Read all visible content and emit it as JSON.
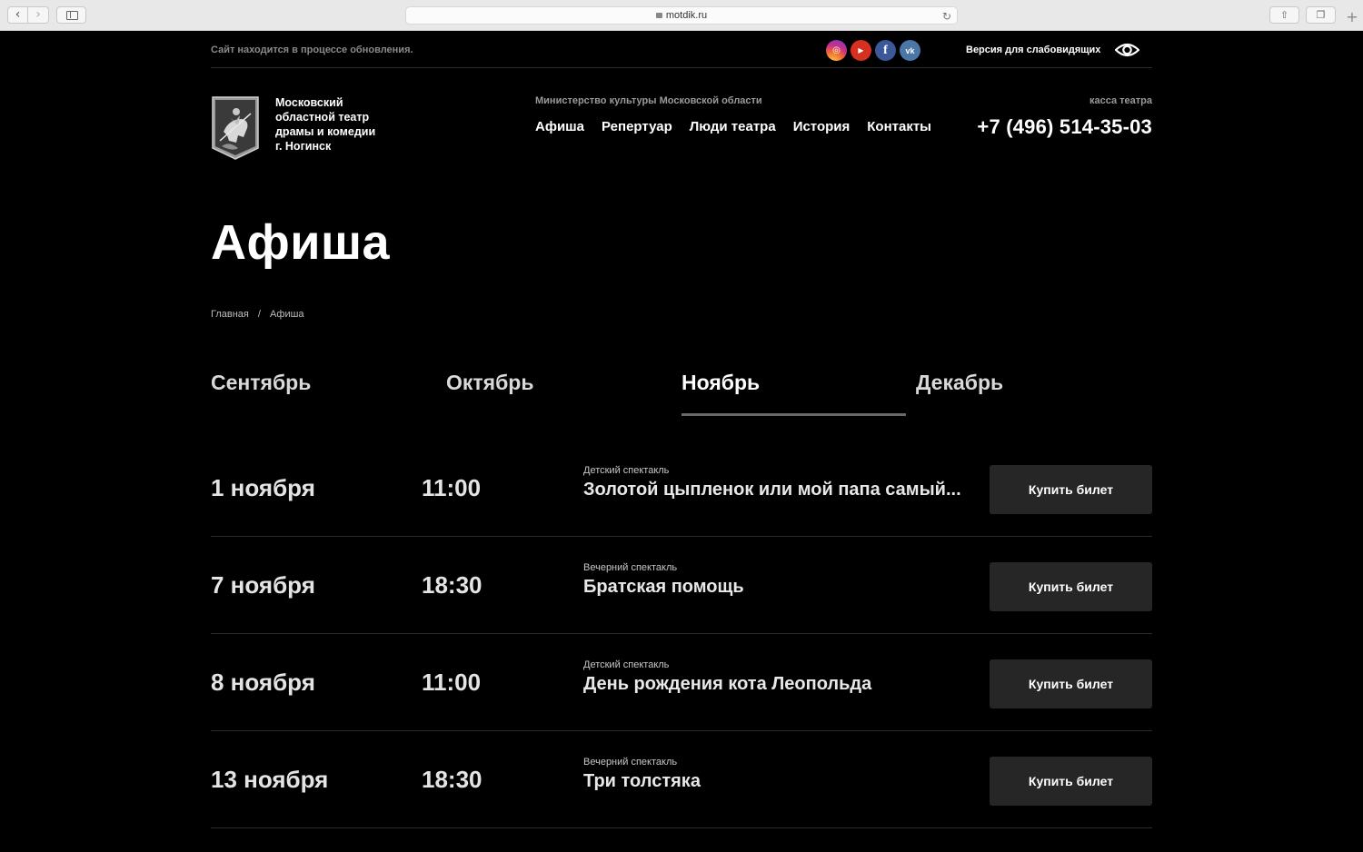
{
  "browser": {
    "url": "motdik.ru"
  },
  "topbar": {
    "notice": "Сайт находится в процессе обновления.",
    "social": [
      "instagram-icon",
      "youtube-icon",
      "facebook-icon",
      "vk-icon"
    ],
    "vision_label": "Версия для слабовидящих"
  },
  "header": {
    "theatre_name_lines": [
      "Московский",
      "областной театр",
      "драмы и комедии",
      "г. Ногинск"
    ],
    "ministry": "Министерство культуры Московской области",
    "menu": [
      "Афиша",
      "Репертуар",
      "Люди театра",
      "История",
      "Контакты"
    ],
    "kassa_label": "касса театра",
    "phone": "+7 (496) 514-35-03"
  },
  "page": {
    "title": "Афиша",
    "breadcrumb": [
      "Главная",
      "/",
      "Афиша"
    ]
  },
  "months": {
    "items": [
      "Сентябрь",
      "Октябрь",
      "Ноябрь",
      "Декабрь"
    ],
    "active": "Ноябрь"
  },
  "events": [
    {
      "date": "1 ноября",
      "time": "11:00",
      "category": "Детский спектакль",
      "title": "Золотой цыпленок или мой папа самый...",
      "button": "Купить билет"
    },
    {
      "date": "7 ноября",
      "time": "18:30",
      "category": "Вечерний спектакль",
      "title": "Братская помощь",
      "button": "Купить билет"
    },
    {
      "date": "8 ноября",
      "time": "11:00",
      "category": "Детский спектакль",
      "title": "День рождения кота Леопольда",
      "button": "Купить билет"
    },
    {
      "date": "13 ноября",
      "time": "18:30",
      "category": "Вечерний спектакль",
      "title": "Три толстяка",
      "button": "Купить билет"
    }
  ],
  "colors": {
    "background": "#000000",
    "button_bg": "#262626",
    "divider": "#2b2b2b"
  }
}
